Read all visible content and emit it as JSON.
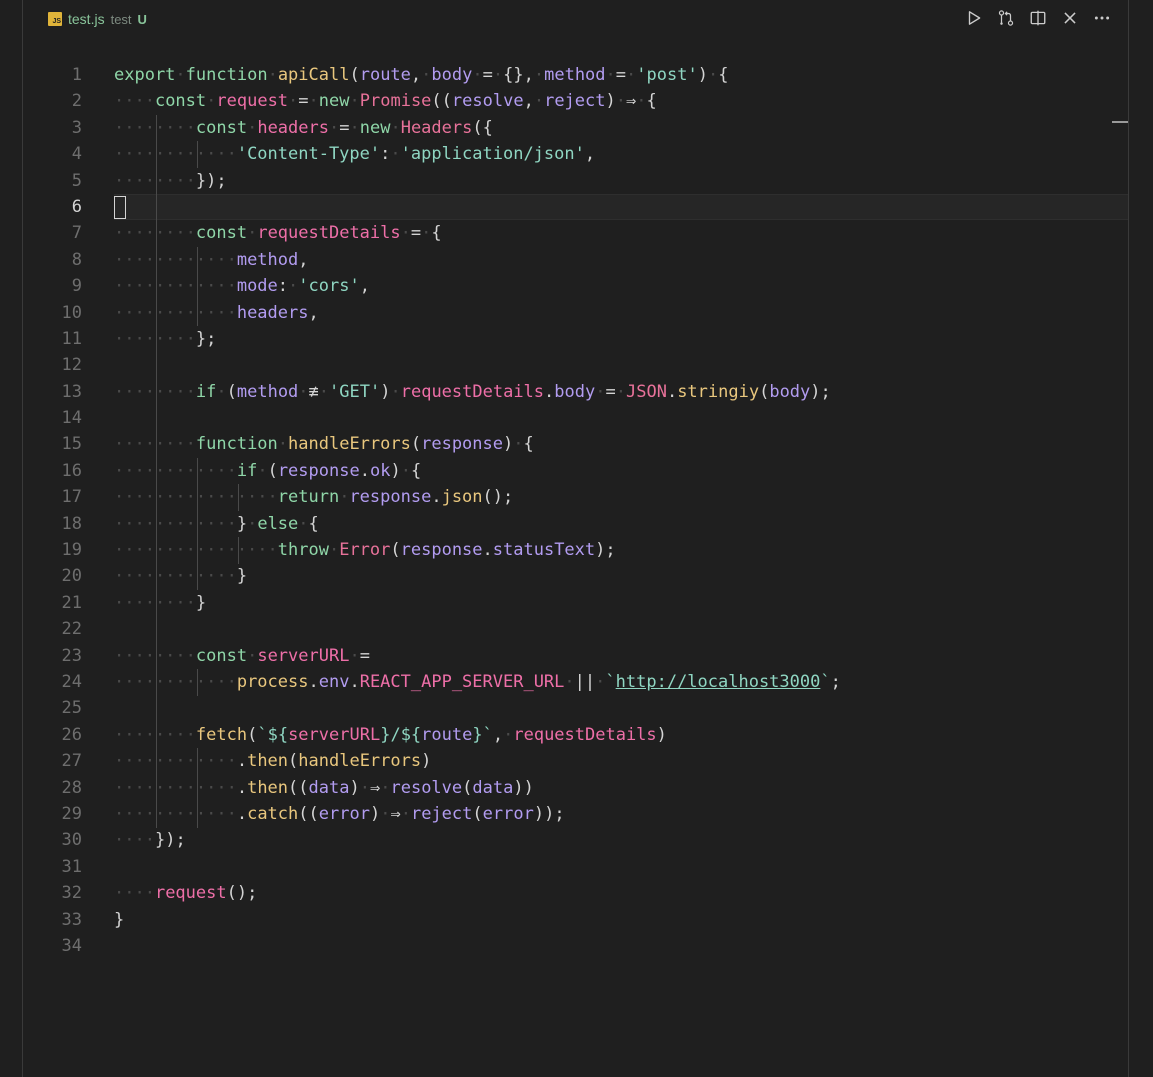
{
  "tab": {
    "badge": "JS",
    "filename": "test.js",
    "folder": "test",
    "git_status": "U"
  },
  "toolbar": [
    {
      "name": "run-icon"
    },
    {
      "name": "open-changes-icon"
    },
    {
      "name": "split-editor-icon"
    },
    {
      "name": "close-icon"
    },
    {
      "name": "more-actions-icon"
    }
  ],
  "editor": {
    "current_line": 6,
    "lines": [
      {
        "n": "1",
        "text": "export function apiCall(route, body = {}, method = 'post') {"
      },
      {
        "n": "2",
        "text": "    const request = new Promise((resolve, reject) ⇒ {"
      },
      {
        "n": "3",
        "text": "        const headers = new Headers({"
      },
      {
        "n": "4",
        "text": "            'Content-Type': 'application/json',"
      },
      {
        "n": "5",
        "text": "        });"
      },
      {
        "n": "6",
        "text": ""
      },
      {
        "n": "7",
        "text": "        const requestDetails = {"
      },
      {
        "n": "8",
        "text": "            method,"
      },
      {
        "n": "9",
        "text": "            mode: 'cors',"
      },
      {
        "n": "10",
        "text": "            headers,"
      },
      {
        "n": "11",
        "text": "        };"
      },
      {
        "n": "12",
        "text": ""
      },
      {
        "n": "13",
        "text": "        if (method ≢ 'GET') requestDetails.body = JSON.stringiy(body);"
      },
      {
        "n": "14",
        "text": ""
      },
      {
        "n": "15",
        "text": "        function handleErrors(response) {"
      },
      {
        "n": "16",
        "text": "            if (response.ok) {"
      },
      {
        "n": "17",
        "text": "                return response.json();"
      },
      {
        "n": "18",
        "text": "            } else {"
      },
      {
        "n": "19",
        "text": "                throw Error(response.statusText);"
      },
      {
        "n": "20",
        "text": "            }"
      },
      {
        "n": "21",
        "text": "        }"
      },
      {
        "n": "22",
        "text": ""
      },
      {
        "n": "23",
        "text": "        const serverURL ="
      },
      {
        "n": "24",
        "text": "            process.env.REACT_APP_SERVER_URL || `http://localhost3000`;"
      },
      {
        "n": "25",
        "text": ""
      },
      {
        "n": "26",
        "text": "        fetch(`${serverURL}/${route}`, requestDetails)"
      },
      {
        "n": "27",
        "text": "            .then(handleErrors)"
      },
      {
        "n": "28",
        "text": "            .then((data) ⇒ resolve(data))"
      },
      {
        "n": "29",
        "text": "            .catch((error) ⇒ reject(error));"
      },
      {
        "n": "30",
        "text": "    });"
      },
      {
        "n": "31",
        "text": ""
      },
      {
        "n": "32",
        "text": "    request();"
      },
      {
        "n": "33",
        "text": "}"
      },
      {
        "n": "34",
        "text": ""
      }
    ]
  },
  "colors": {
    "background": "#1f1f1f",
    "keyword": "#8fd6a8",
    "function": "#e9c77e",
    "variable": "#ee6fa8",
    "parameter": "#b29cf0",
    "string": "#8fd6c2",
    "class": "#e8729a",
    "plain": "#d4d4d4"
  }
}
